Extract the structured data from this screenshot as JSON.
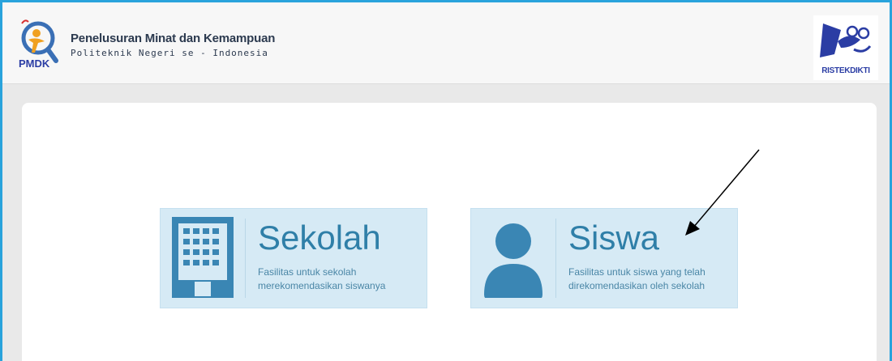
{
  "header": {
    "logo_text": "PMDK",
    "title": "Penelusuran Minat dan Kemampuan",
    "subtitle": "Politeknik Negeri se - Indonesia",
    "partner_logo_text": "RISTEKDIKTI"
  },
  "cards": [
    {
      "heading": "Sekolah",
      "description": "Fasilitas untuk sekolah merekomendasikan siswanya",
      "icon": "building-icon"
    },
    {
      "heading": "Siswa",
      "description": "Fasilitas untuk siswa yang telah direkomendasikan oleh sekolah",
      "icon": "user-icon"
    }
  ],
  "colors": {
    "frame_border": "#29a3dc",
    "card_bg": "#d6eaf5",
    "accent": "#2f7fa8",
    "icon": "#3a86b4"
  }
}
